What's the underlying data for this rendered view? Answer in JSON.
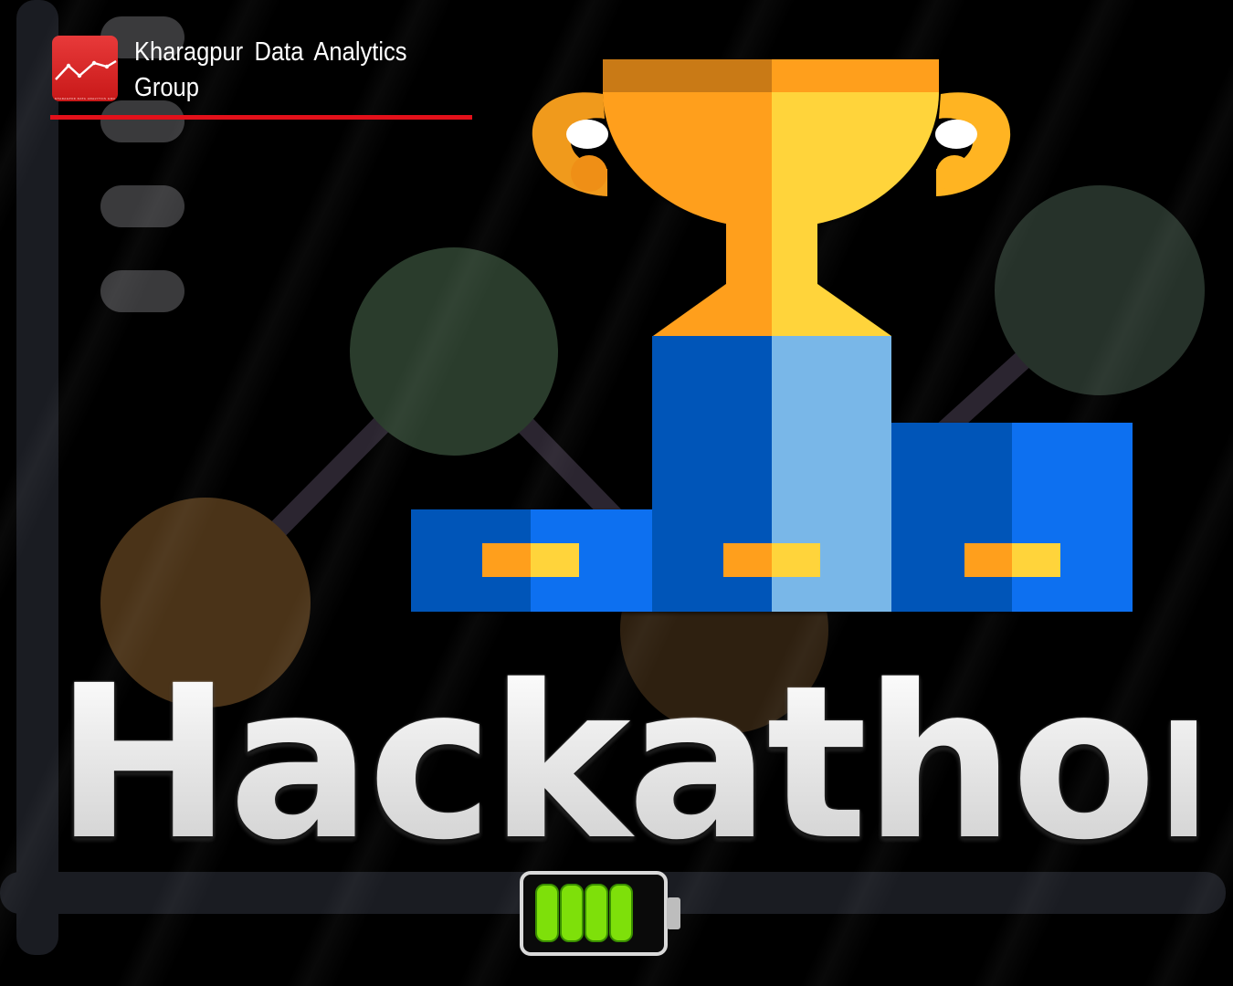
{
  "header": {
    "org_name": "Kharagpur Data Analytics Group",
    "logo_caption": "KHARAGPUR DATA ANALYTICS GROUP",
    "logo_icon": "line-chart-icon",
    "rule_color": "#e3101a"
  },
  "illustration": {
    "icon": "trophy-on-podium-icon",
    "trophy_colors": [
      "#ff9f1c",
      "#ffd43b"
    ],
    "podium_colors": [
      "#0055b8",
      "#0a6ff0",
      "#79b7e8"
    ]
  },
  "title": "Hackathon",
  "battery": {
    "icon": "battery-full-icon",
    "bars": 4,
    "color": "#7ee00a"
  }
}
